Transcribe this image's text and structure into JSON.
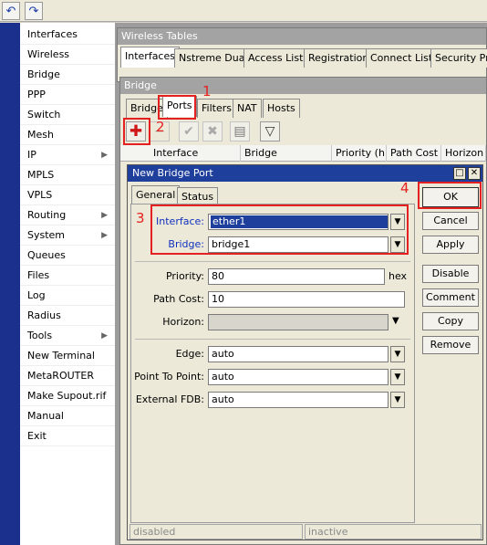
{
  "toolbar": {
    "undo_icon": "undo-icon",
    "redo_icon": "redo-icon"
  },
  "menu": [
    {
      "label": "Interfaces",
      "arrow": false
    },
    {
      "label": "Wireless",
      "arrow": false
    },
    {
      "label": "Bridge",
      "arrow": false
    },
    {
      "label": "PPP",
      "arrow": false
    },
    {
      "label": "Switch",
      "arrow": false
    },
    {
      "label": "Mesh",
      "arrow": false
    },
    {
      "label": "IP",
      "arrow": true
    },
    {
      "label": "MPLS",
      "arrow": false
    },
    {
      "label": "VPLS",
      "arrow": false
    },
    {
      "label": "Routing",
      "arrow": true
    },
    {
      "label": "System",
      "arrow": true
    },
    {
      "label": "Queues",
      "arrow": false
    },
    {
      "label": "Files",
      "arrow": false
    },
    {
      "label": "Log",
      "arrow": false
    },
    {
      "label": "Radius",
      "arrow": false
    },
    {
      "label": "Tools",
      "arrow": true
    },
    {
      "label": "New Terminal",
      "arrow": false
    },
    {
      "label": "MetaROUTER",
      "arrow": false
    },
    {
      "label": "Make Supout.rif",
      "arrow": false
    },
    {
      "label": "Manual",
      "arrow": false
    },
    {
      "label": "Exit",
      "arrow": false
    }
  ],
  "wireless_tables": {
    "title": "Wireless Tables",
    "tabs": [
      "Interfaces",
      "Nstreme Dual",
      "Access List",
      "Registration",
      "Connect List",
      "Security Pro"
    ]
  },
  "bridge": {
    "title": "Bridge",
    "tabs": [
      "Bridge",
      "Ports",
      "Filters",
      "NAT",
      "Hosts"
    ],
    "columns": [
      "Interface",
      "Bridge",
      "Priority (h...",
      "Path Cost",
      "Horizon"
    ]
  },
  "dialog": {
    "title": "New Bridge Port",
    "tabs": [
      "General",
      "Status"
    ],
    "fields": {
      "interface_label": "Interface:",
      "interface_value": "ether1",
      "bridge_label": "Bridge:",
      "bridge_value": "bridge1",
      "priority_label": "Priority:",
      "priority_value": "80",
      "priority_unit": "hex",
      "path_cost_label": "Path Cost:",
      "path_cost_value": "10",
      "horizon_label": "Horizon:",
      "horizon_value": "",
      "edge_label": "Edge:",
      "edge_value": "auto",
      "p2p_label": "Point To Point:",
      "p2p_value": "auto",
      "fdb_label": "External FDB:",
      "fdb_value": "auto"
    },
    "buttons": {
      "ok": "OK",
      "cancel": "Cancel",
      "apply": "Apply",
      "disable": "Disable",
      "comment": "Comment",
      "copy": "Copy",
      "remove": "Remove"
    },
    "status_left": "disabled",
    "status_right": "inactive"
  },
  "annotations": [
    "1",
    "2",
    "3",
    "4"
  ],
  "colors": {
    "annotation": "#e52020",
    "title_active": "#1f3f9c",
    "label_blue": "#1030c0"
  }
}
